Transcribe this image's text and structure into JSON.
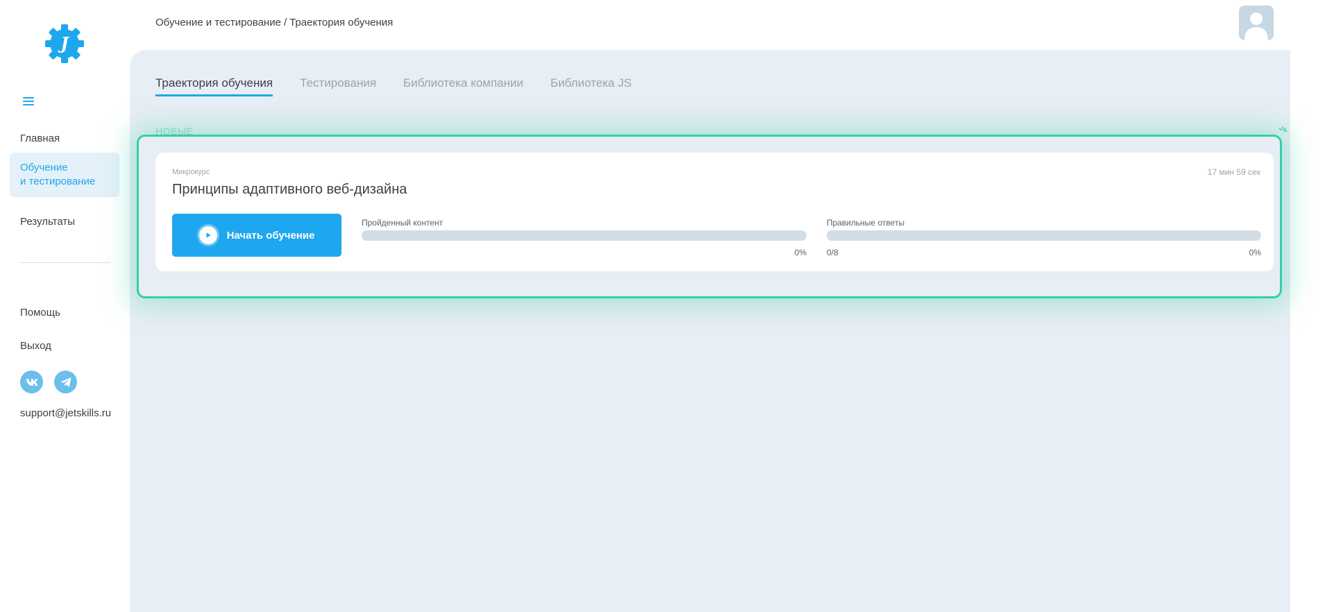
{
  "colors": {
    "accent": "#1ea7ee",
    "highlight": "#35cfa3",
    "main_background": "#e8eef5",
    "track": "#d2dde6"
  },
  "sidebar": {
    "logo_letter": "J",
    "menu_icon": "hamburger-icon",
    "items": [
      {
        "label": "Главная",
        "active": false
      },
      {
        "label": "Обучение\nи тестирование",
        "active": true
      },
      {
        "label": "Результаты",
        "active": false
      }
    ],
    "bottom_items": [
      {
        "label": "Помощь"
      },
      {
        "label": "Выход"
      }
    ],
    "socials": [
      {
        "icon": "vk-icon"
      },
      {
        "icon": "telegram-icon"
      }
    ],
    "support_email": "support@jetskills.ru"
  },
  "header": {
    "breadcrumb": [
      "Обучение и тестирование",
      "Траектория обучения"
    ],
    "breadcrumb_separator": "/",
    "avatar_icon": "user-avatar-icon"
  },
  "main": {
    "tabs": [
      {
        "label": "Траектория обучения",
        "active": true
      },
      {
        "label": "Тестирования",
        "active": false
      },
      {
        "label": "Библиотека компании",
        "active": false
      },
      {
        "label": "Библиотека JS",
        "active": false
      }
    ],
    "section_label": "НОВЫЕ",
    "course": {
      "type": "Микрокурс",
      "duration": "17 мин 59 сек",
      "title": "Принципы адаптивного веб-дизайна",
      "start_button_label": "Начать обучение",
      "progress_content": {
        "label": "Пройденный контент",
        "value_percent": 0,
        "right_text": "0%"
      },
      "progress_answers": {
        "label": "Правильные ответы",
        "value_percent": 0,
        "left_text": "0/8",
        "right_text": "0%"
      }
    }
  }
}
